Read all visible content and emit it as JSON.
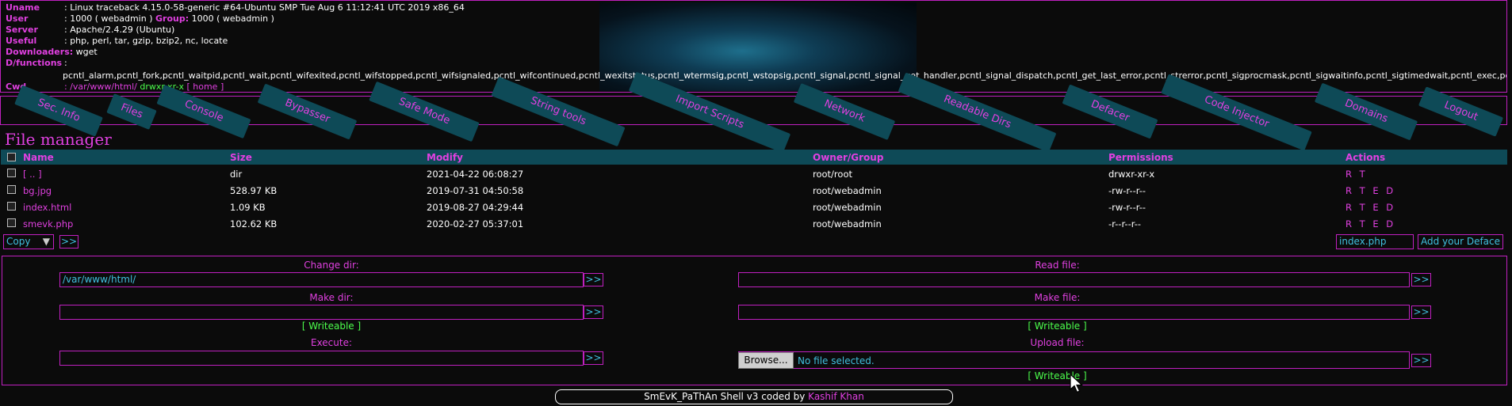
{
  "info": {
    "uname_label": "Uname",
    "uname": ": Linux traceback 4.15.0-58-generic #64-Ubuntu SMP Tue Aug 6 11:12:41 UTC 2019 x86_64",
    "user_label": "User",
    "user": ": 1000 ( webadmin )",
    "group_label": "Group:",
    "group": "1000 ( webadmin )",
    "server_label": "Server",
    "server": ": Apache/2.4.29 (Ubuntu)",
    "useful_label": "Useful",
    "useful": ": php, perl, tar, gzip, bzip2, nc, locate",
    "downloaders_label": "Downloaders:",
    "downloaders": "wget",
    "dfunctions_label": "D/functions",
    "dfunctions_sep": ":",
    "dfunctions": "pcntl_alarm,pcntl_fork,pcntl_waitpid,pcntl_wait,pcntl_wifexited,pcntl_wifstopped,pcntl_wifsignaled,pcntl_wifcontinued,pcntl_wexitstatus,pcntl_wtermsig,pcntl_wstopsig,pcntl_signal,pcntl_signal_get_handler,pcntl_signal_dispatch,pcntl_get_last_error,pcntl_strerror,pcntl_sigprocmask,pcntl_sigwaitinfo,pcntl_sigtimedwait,pcntl_exec,pcntl_getpriority,pcntl_setpriority,pcntl_async_signals",
    "cwd_label": "Cwd",
    "cwd": ": /var/www/html/",
    "cwd_perm": "drwxr-xr-x",
    "home_link": "[ home ]"
  },
  "menu": [
    "Sec. Info",
    "Files",
    "Console",
    "Bypasser",
    "Safe Mode",
    "String tools",
    "Import Scripts",
    "Network",
    "Readable Dirs",
    "Defacer",
    "Code Injector",
    "Domains",
    "Logout"
  ],
  "file_manager": {
    "title": "File manager",
    "columns": [
      "Name",
      "Size",
      "Modify",
      "Owner/Group",
      "Permissions",
      "Actions"
    ],
    "rows": [
      {
        "name": "[ .. ]",
        "size": "dir",
        "modify": "2021-04-22 06:08:27",
        "owner": "root/root",
        "perms": "drwxr-xr-x",
        "actions": "R T"
      },
      {
        "name": "bg.jpg",
        "size": "528.97 KB",
        "modify": "2019-07-31 04:50:58",
        "owner": "root/webadmin",
        "perms": "-rw-r--r--",
        "actions": "R T E D"
      },
      {
        "name": "index.html",
        "size": "1.09 KB",
        "modify": "2019-08-27 04:29:44",
        "owner": "root/webadmin",
        "perms": "-rw-r--r--",
        "actions": "R T E D"
      },
      {
        "name": "smevk.php",
        "size": "102.62 KB",
        "modify": "2020-02-27 05:37:01",
        "owner": "root/webadmin",
        "perms": "-r--r--r--",
        "actions": "R T E D"
      }
    ],
    "copy_select": "Copy",
    "go": ">>",
    "deface_filename": "index.php",
    "deface_button": "Add your Deface"
  },
  "tools": {
    "change_dir_label": "Change dir:",
    "change_dir_value": "/var/www/html/",
    "read_file_label": "Read file:",
    "make_dir_label": "Make dir:",
    "make_file_label": "Make file:",
    "writeable": "[ Writeable ]",
    "execute_label": "Execute:",
    "upload_file_label": "Upload file:",
    "browse_button": "Browse...",
    "no_file": "No file selected.",
    "go": ">>"
  },
  "footer": {
    "text": "SmEvK_PaThAn Shell v3 coded by",
    "author": "Kashif Khan"
  },
  "colors": {
    "accent": "#e040e0",
    "tab_bg": "#0e4a57",
    "ok": "#4cff4c",
    "input_text": "#40c0e0"
  }
}
